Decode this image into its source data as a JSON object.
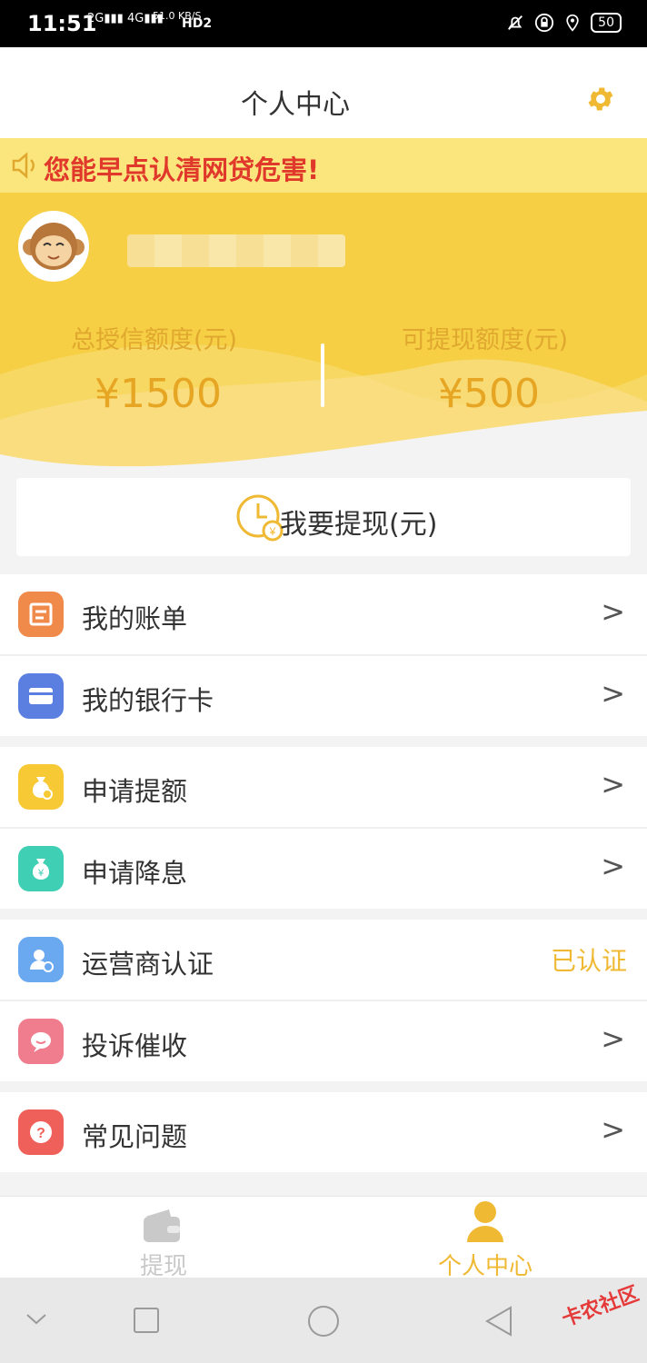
{
  "status_bar": {
    "time": "11:51",
    "signal1": "2G",
    "signal2": "4G",
    "net_speed": "51.0 KB/S",
    "hd": "HD2",
    "battery": "50"
  },
  "header": {
    "title": "个人中心"
  },
  "notice": {
    "text": "您能早点认清网贷危害!"
  },
  "hero": {
    "total_credit_label": "总授信额度(元)",
    "total_credit_value": "¥1500",
    "withdrawable_label": "可提现额度(元)",
    "withdrawable_value": "¥500"
  },
  "withdraw": {
    "label": "我要提现(元)"
  },
  "menu": [
    {
      "label": "我的账单",
      "icon": "bill-icon",
      "color": "#f08a4b"
    },
    {
      "label": "我的银行卡",
      "icon": "bank-card-icon",
      "color": "#5b7fe0"
    },
    {
      "label": "申请提额",
      "icon": "money-bag-icon",
      "color": "#f7c934"
    },
    {
      "label": "申请降息",
      "icon": "money-bag-yen-icon",
      "color": "#3fcfb4"
    },
    {
      "label": "运营商认证",
      "icon": "user-verify-icon",
      "color": "#6aa8ef",
      "status": "已认证"
    },
    {
      "label": "投诉催收",
      "icon": "chat-icon",
      "color": "#f07d8e"
    },
    {
      "label": "常见问题",
      "icon": "question-icon",
      "color": "#f0605a"
    }
  ],
  "tabs": [
    {
      "label": "提现",
      "active": false
    },
    {
      "label": "个人中心",
      "active": true
    }
  ],
  "watermark": "卡农社区",
  "colors": {
    "accent": "#f6d04b",
    "active_tab": "#f0b933",
    "inactive_tab": "#c9c9c9"
  }
}
